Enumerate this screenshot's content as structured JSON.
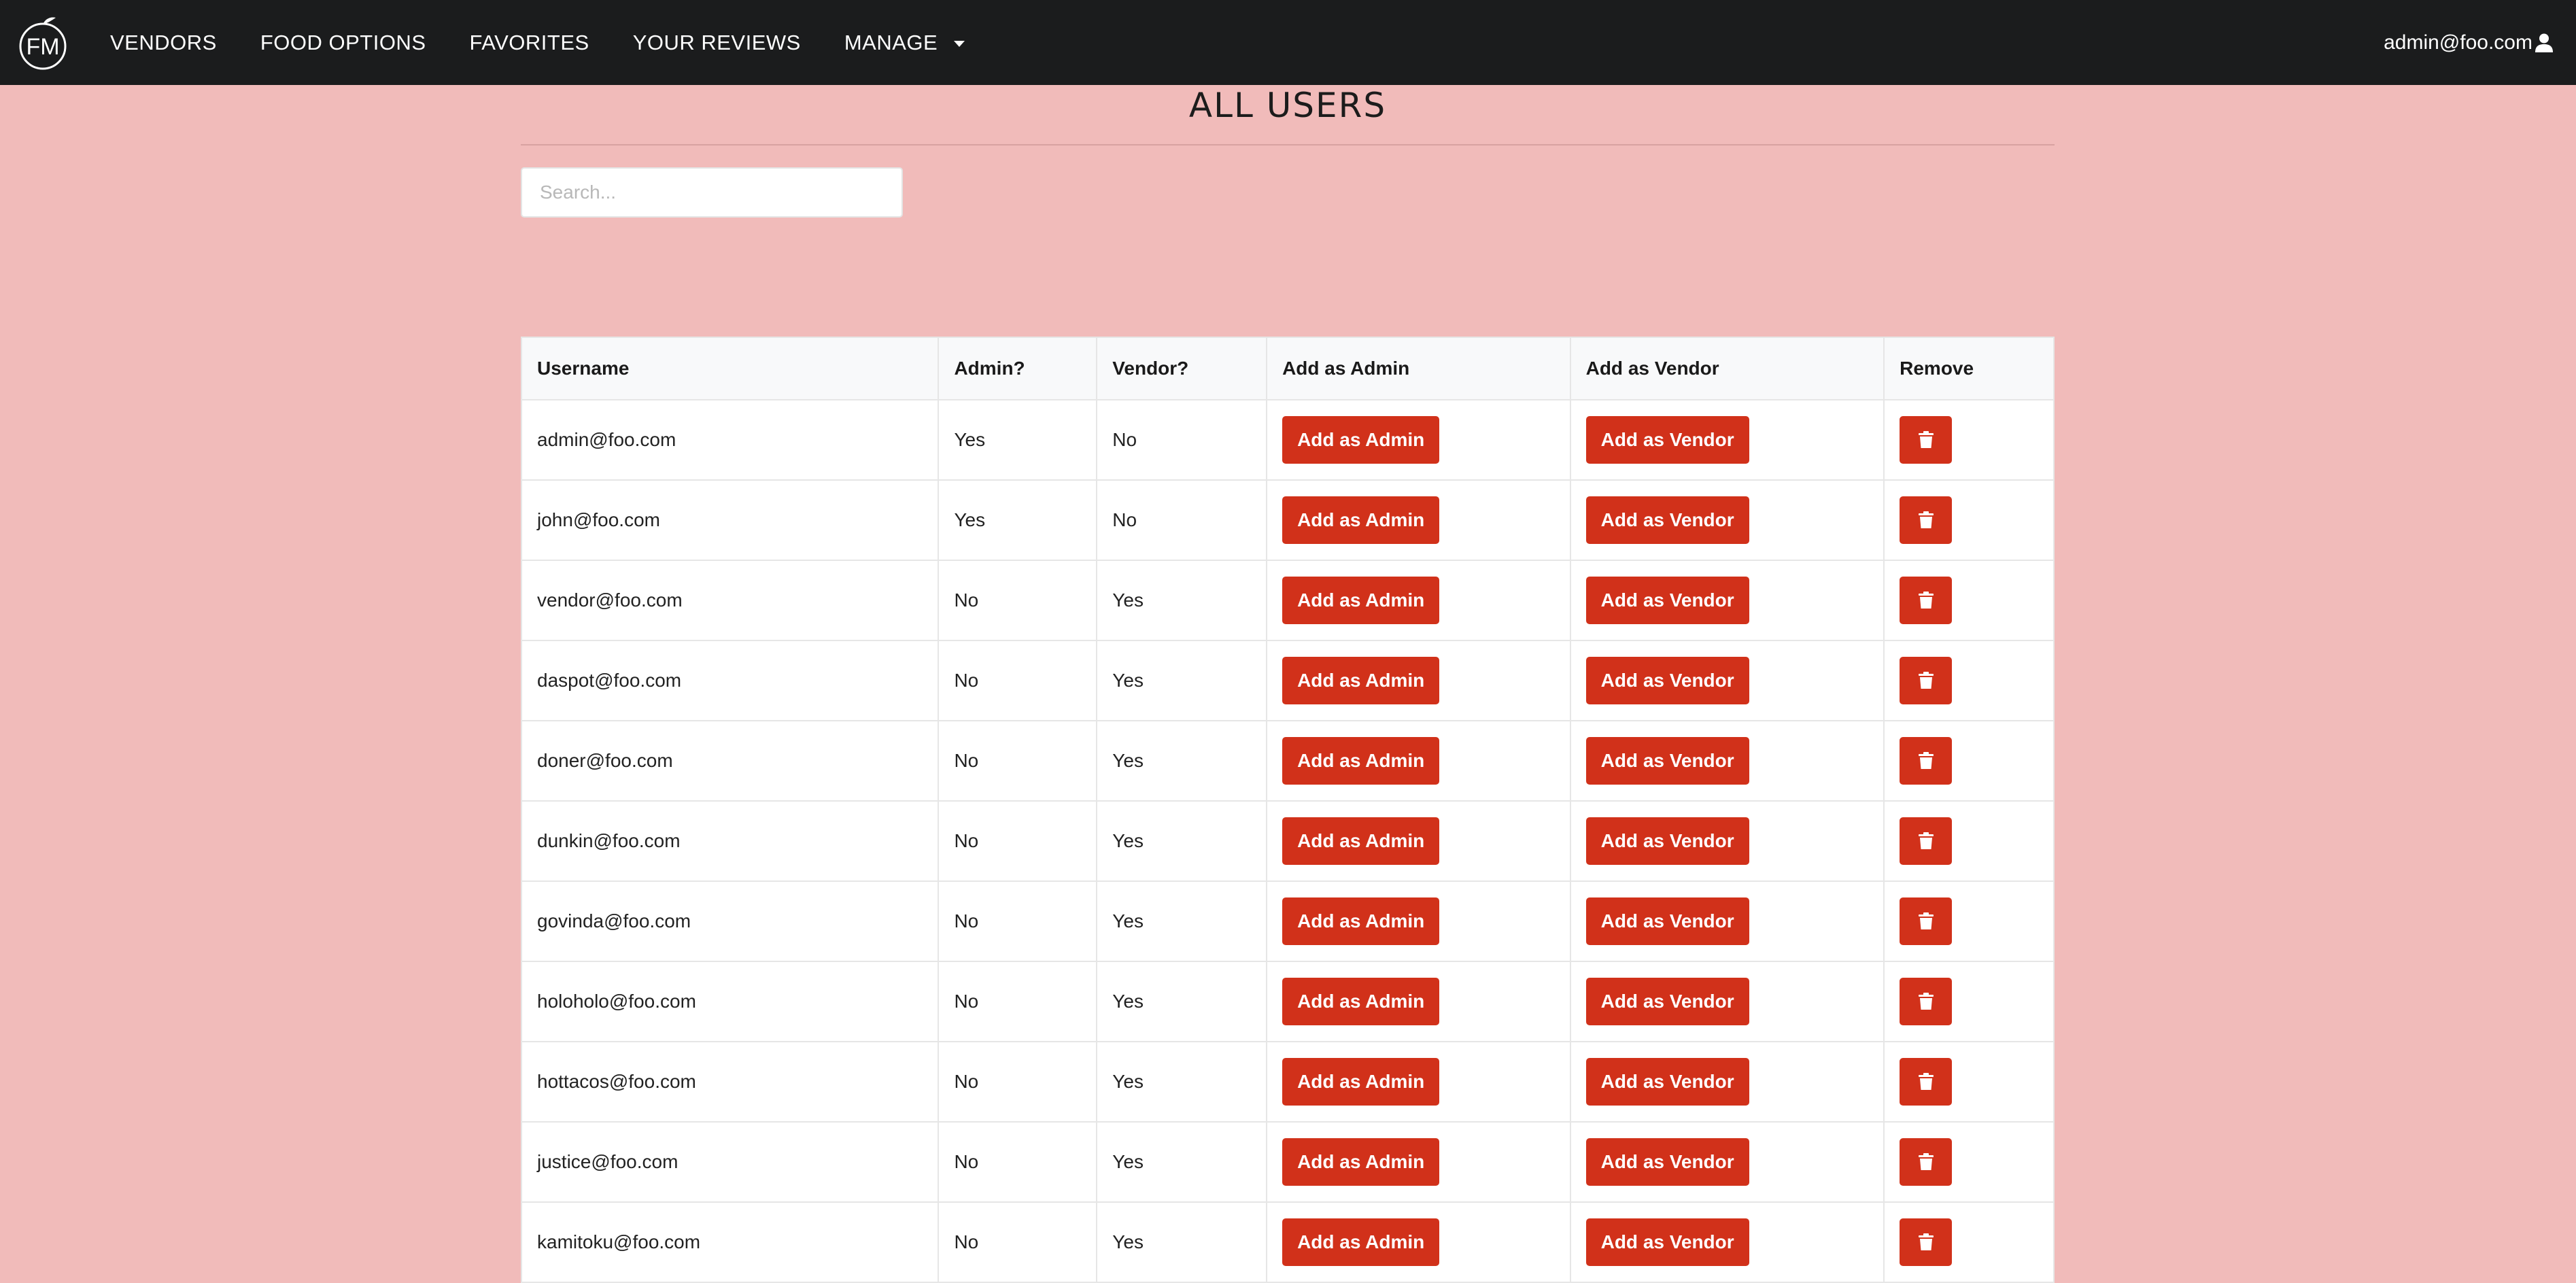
{
  "app": {
    "logo_text": "FM"
  },
  "nav": {
    "items": [
      {
        "label": "VENDORS"
      },
      {
        "label": "FOOD OPTIONS"
      },
      {
        "label": "FAVORITES"
      },
      {
        "label": "YOUR REVIEWS"
      },
      {
        "label": "MANAGE"
      }
    ],
    "user_label": "admin@foo.com"
  },
  "page": {
    "title": "ALL USERS",
    "search_placeholder": "Search..."
  },
  "table": {
    "headers": {
      "username": "Username",
      "admin": "Admin?",
      "vendor": "Vendor?",
      "add_admin": "Add as Admin",
      "add_vendor": "Add as Vendor",
      "remove": "Remove"
    },
    "button_labels": {
      "add_admin": "Add as Admin",
      "add_vendor": "Add as Vendor"
    },
    "rows": [
      {
        "username": "admin@foo.com",
        "admin": "Yes",
        "vendor": "No"
      },
      {
        "username": "john@foo.com",
        "admin": "Yes",
        "vendor": "No"
      },
      {
        "username": "vendor@foo.com",
        "admin": "No",
        "vendor": "Yes"
      },
      {
        "username": "daspot@foo.com",
        "admin": "No",
        "vendor": "Yes"
      },
      {
        "username": "doner@foo.com",
        "admin": "No",
        "vendor": "Yes"
      },
      {
        "username": "dunkin@foo.com",
        "admin": "No",
        "vendor": "Yes"
      },
      {
        "username": "govinda@foo.com",
        "admin": "No",
        "vendor": "Yes"
      },
      {
        "username": "holoholo@foo.com",
        "admin": "No",
        "vendor": "Yes"
      },
      {
        "username": "hottacos@foo.com",
        "admin": "No",
        "vendor": "Yes"
      },
      {
        "username": "justice@foo.com",
        "admin": "No",
        "vendor": "Yes"
      },
      {
        "username": "kamitoku@foo.com",
        "admin": "No",
        "vendor": "Yes"
      }
    ]
  },
  "colors": {
    "background": "#f1bbba",
    "navbar": "#1b1c1d",
    "accent_red": "#d1311a"
  },
  "icons": {
    "logo": "fm-logo-icon",
    "caret": "caret-down-icon",
    "user": "user-icon",
    "trash": "trash-icon"
  }
}
